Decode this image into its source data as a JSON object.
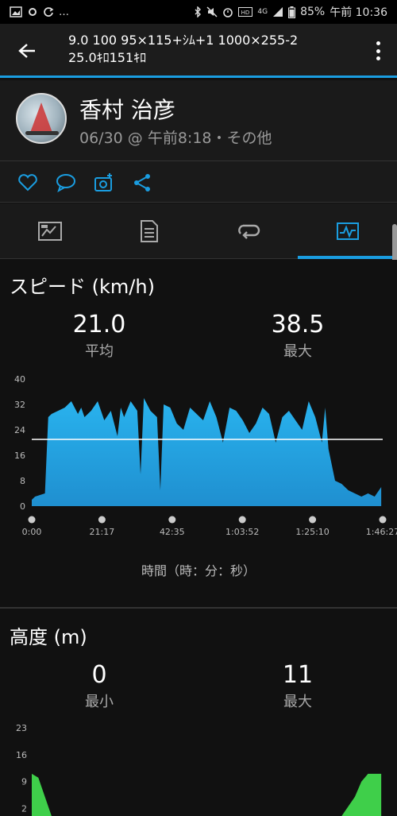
{
  "status_bar": {
    "left_icons": [
      "image-icon",
      "sync-icon",
      "more-notifications-icon"
    ],
    "left_text": "…",
    "battery": "85%",
    "time": "午前 10:36",
    "network": "4G"
  },
  "header": {
    "title_line1": "9.0 100 95×115+ｼﾑ+1 1000×255-2",
    "title_line2": "25.0ｷﾛ151ｷﾛ"
  },
  "profile": {
    "name": "香村 治彦",
    "meta": "06/30 @ 午前8:18・その他"
  },
  "actions": [
    "like-icon",
    "comment-icon",
    "add-photo-icon",
    "share-icon"
  ],
  "tabs": [
    {
      "name": "summary-tab",
      "icon": "map-summary-icon",
      "active": false
    },
    {
      "name": "details-tab",
      "icon": "document-icon",
      "active": false
    },
    {
      "name": "laps-tab",
      "icon": "laps-icon",
      "active": false
    },
    {
      "name": "charts-tab",
      "icon": "chart-icon",
      "active": true
    }
  ],
  "speed": {
    "title": "スピード (km/h)",
    "avg_value": "21.0",
    "avg_label": "平均",
    "max_value": "38.5",
    "max_label": "最大",
    "x_caption": "時間（時：分：秒）"
  },
  "altitude": {
    "title": "高度 (m)",
    "min_value": "0",
    "min_label": "最小",
    "max_value": "11",
    "max_label": "最大"
  },
  "colors": {
    "accent": "#1a9de0",
    "speed_fill": "#1f8fd0",
    "altitude_fill": "#3fcf4a"
  },
  "chart_data": [
    {
      "type": "area",
      "title": "スピード (km/h)",
      "xlabel": "時間（時：分：秒）",
      "ylabel": "",
      "x_tick_labels": [
        "0:00",
        "21:17",
        "42:35",
        "1:03:52",
        "1:25:10",
        "1:46:27"
      ],
      "y_ticks": [
        0,
        8,
        16,
        24,
        32,
        40
      ],
      "ylim": [
        0,
        40
      ],
      "xlim": [
        0,
        106.45
      ],
      "x_unit": "minutes",
      "average_line": 21.0,
      "x": [
        0,
        1,
        4,
        5,
        6,
        8,
        10,
        12,
        14,
        15,
        16,
        18,
        20,
        22,
        24,
        26,
        27,
        28,
        30,
        32,
        33,
        34,
        36,
        38,
        39,
        40,
        42,
        44,
        46,
        48,
        50,
        52,
        54,
        56,
        58,
        60,
        62,
        64,
        66,
        68,
        70,
        72,
        74,
        76,
        78,
        80,
        82,
        84,
        86,
        88,
        89,
        90,
        92,
        94,
        96,
        98,
        100,
        102,
        104,
        106
      ],
      "series": [
        {
          "values": [
            2,
            3,
            4,
            28,
            29,
            30,
            31,
            33,
            29,
            31,
            28,
            30,
            33,
            27,
            30,
            22,
            31,
            28,
            33,
            30,
            10,
            34,
            30,
            28,
            5,
            32,
            31,
            26,
            24,
            31,
            29,
            27,
            33,
            28,
            20,
            31,
            30,
            27,
            23,
            26,
            31,
            29,
            20,
            28,
            30,
            27,
            24,
            33,
            28,
            20,
            31,
            18,
            8,
            7,
            5,
            4,
            3,
            4,
            3,
            6
          ]
        }
      ]
    },
    {
      "type": "area",
      "title": "高度 (m)",
      "y_ticks": [
        2,
        9,
        16,
        23
      ],
      "ylim": [
        0,
        23
      ],
      "x": [
        0,
        2,
        4,
        6,
        90,
        94,
        98,
        100,
        102,
        104,
        106
      ],
      "series": [
        {
          "values": [
            11,
            10,
            5,
            0,
            0,
            0,
            5,
            9,
            11,
            11,
            11
          ]
        }
      ]
    }
  ]
}
